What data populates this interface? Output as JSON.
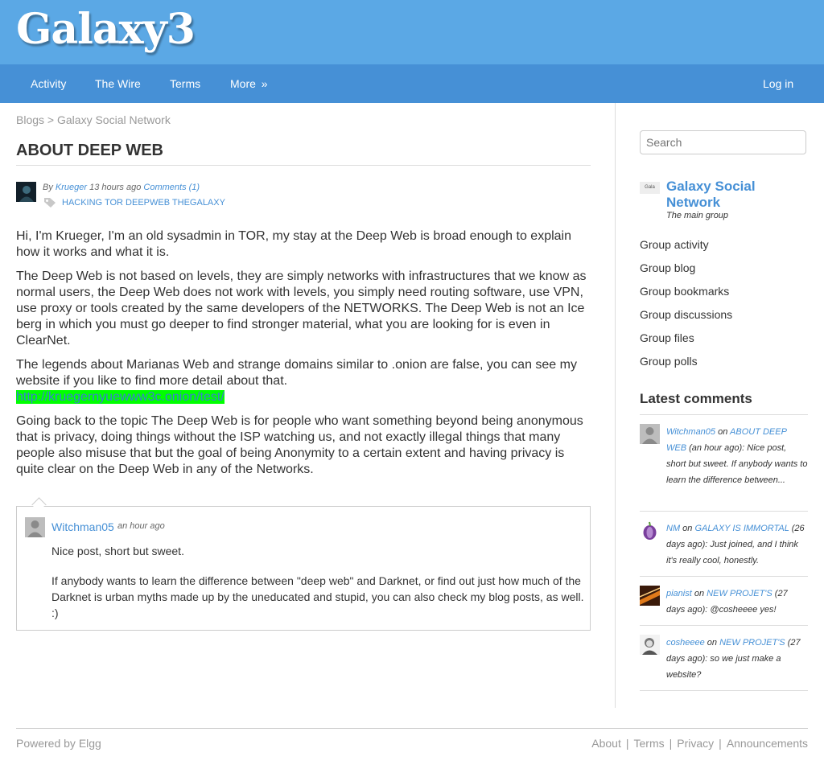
{
  "header": {
    "site_name": "Galaxy3"
  },
  "nav": {
    "items": [
      "Activity",
      "The Wire",
      "Terms",
      "More"
    ],
    "more_chevron": "»",
    "login": "Log in"
  },
  "breadcrumb": {
    "parent": "Blogs",
    "separator": ">",
    "current": "Galaxy Social Network"
  },
  "post": {
    "title": "ABOUT DEEP WEB",
    "by": "By",
    "author": "Krueger",
    "time": "13 hours ago",
    "comments_link": "Comments (1)",
    "tags": "HACKING TOR DEEPWEB THEGALAXY",
    "paragraphs": [
      "Hi, I'm Krueger, I'm an old sysadmin in TOR, my stay at the Deep Web is broad enough to explain how it works and what it is.",
      "The Deep Web is not based on levels, they are simply networks with infrastructures that we know as normal users, the Deep Web does not work with levels, you simply need routing software, use VPN, use proxy or tools created by the same developers of the NETWORKS. The Deep Web is not an Ice berg in which you must go deeper to find stronger material, what you are looking for is even in ClearNet.",
      "The legends about Marianas Web and strange domains similar to .onion are false, you can see my website if you like to find more detail about that."
    ],
    "link": "http://kruegernyuewww3c.onion/test/",
    "paragraph_last": "Going back to the topic The Deep Web is for people who want something beyond being anonymous that is privacy, doing things without the ISP watching us, and not exactly illegal things that many people also misuse that but the goal of being Anonymity to a certain extent and having privacy is quite clear on the Deep Web in any of the Networks."
  },
  "comment": {
    "user": "Witchman05",
    "time": "an hour ago",
    "line1": "Nice post, short but sweet.",
    "line2": "If anybody wants to learn the difference between \"deep web\" and Darknet, or find out just how much of the Darknet is urban myths made up by the uneducated and stupid, you can also check my blog posts, as well. :)"
  },
  "sidebar": {
    "search_placeholder": "Search",
    "group_icon_text": "Gala",
    "group_name": "Galaxy Social Network",
    "group_subtitle": "The main group",
    "group_links": [
      "Group activity",
      "Group blog",
      "Group bookmarks",
      "Group discussions",
      "Group files",
      "Group polls"
    ],
    "latest_heading": "Latest comments",
    "on": "on",
    "latest": [
      {
        "user": "Witchman05",
        "target": "ABOUT DEEP WEB",
        "text": "(an hour ago): Nice post, short but sweet. If anybody wants to learn the difference between..."
      },
      {
        "user": "NM",
        "target": "GALAXY IS IMMORTAL",
        "text": "(26 days ago): Just joined, and I think it's really cool, honestly."
      },
      {
        "user": "pianist",
        "target": "NEW PROJET'S",
        "text": "(27 days ago): @cosheeee yes!"
      },
      {
        "user": "cosheeee",
        "target": "NEW PROJET'S",
        "text": "(27 days ago): so we just make a website?"
      }
    ]
  },
  "footer": {
    "powered": "Powered by Elgg",
    "links": [
      "About",
      "Terms",
      "Privacy",
      "Announcements"
    ],
    "separator": "|"
  }
}
